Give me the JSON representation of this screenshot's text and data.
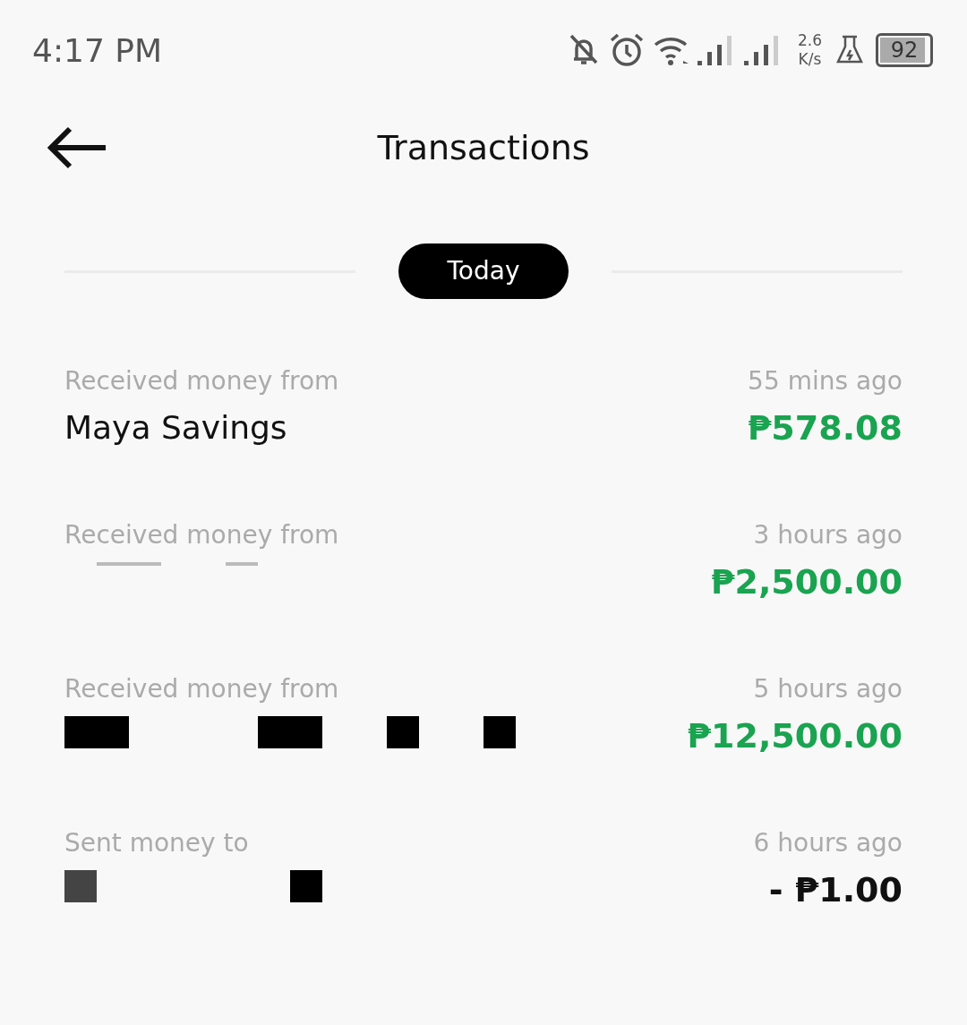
{
  "status_bar": {
    "time": "4:17 PM",
    "net_speed": "2.6",
    "net_unit": "K/s",
    "battery": "92"
  },
  "header": {
    "title": "Transactions"
  },
  "section": {
    "label": "Today"
  },
  "transactions": [
    {
      "label": "Received money from",
      "name": "Maya Savings",
      "kind": "named",
      "time": "55 mins ago",
      "amount": "₱578.08",
      "outgoing": false
    },
    {
      "label": "Received money from",
      "kind": "redacted",
      "time": "3 hours ago",
      "amount": "₱2,500.00",
      "outgoing": false
    },
    {
      "label": "Received money from",
      "kind": "redacted",
      "time": "5 hours ago",
      "amount": "₱12,500.00",
      "outgoing": false
    },
    {
      "label": "Sent money to",
      "kind": "redacted",
      "time": "6 hours ago",
      "amount": "- ₱1.00",
      "outgoing": true
    }
  ]
}
